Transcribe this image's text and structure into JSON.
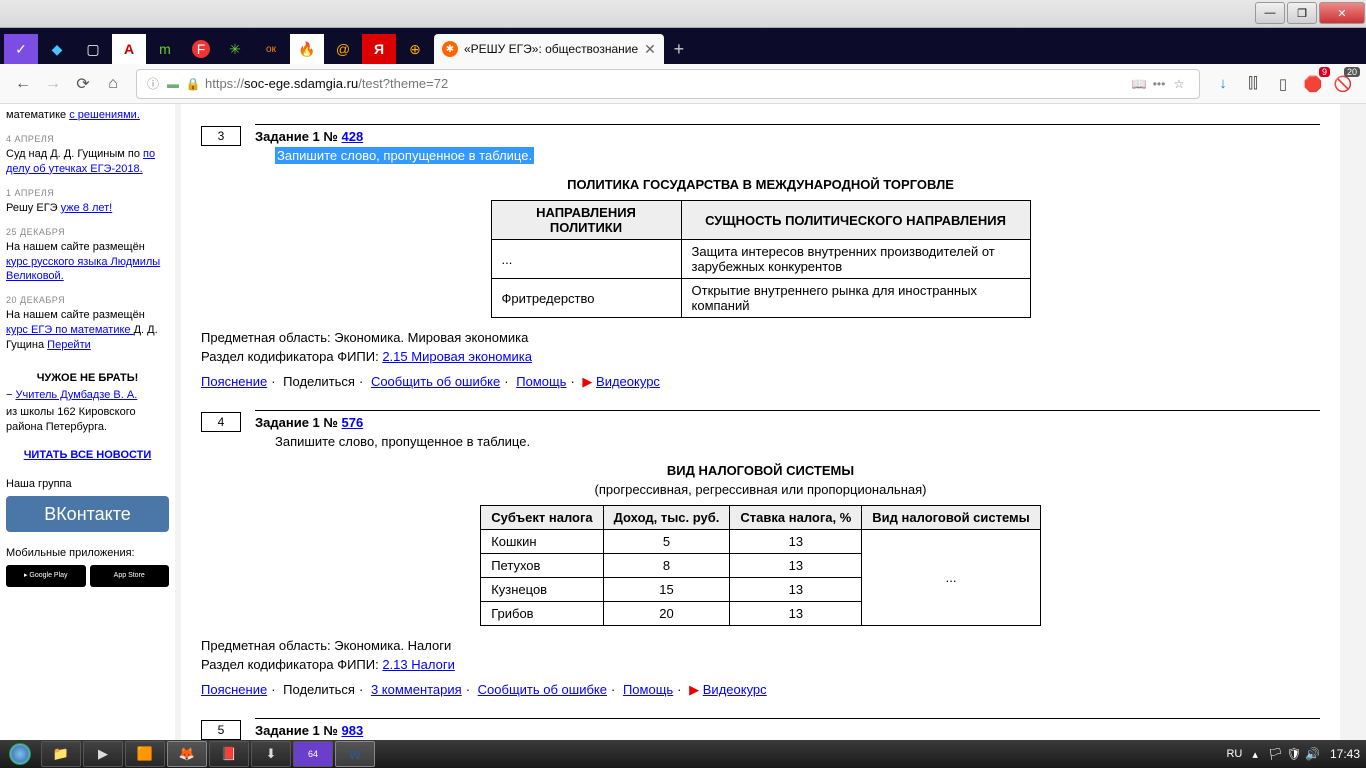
{
  "window": {
    "minimize": "—",
    "maximize": "❐",
    "close": "✕"
  },
  "tabs": {
    "active_title": "«РЕШУ ЕГЭ»: обществознание",
    "close": "✕",
    "new": "+"
  },
  "nav": {
    "back": "←",
    "forward": "→",
    "reload": "⟳",
    "home": "⌂",
    "info": "ⓘ",
    "shield": "🛡",
    "lock": "🔒",
    "url_prefix": "https://",
    "url_host": "soc-ege.sdamgia.ru",
    "url_path": "/test?theme=72",
    "reader": "📖",
    "dots": "•••",
    "star": "☆",
    "download": "↓",
    "library": "⫿⫿",
    "sidebar": "▯",
    "adb": "9",
    "noscript": "20"
  },
  "sidebar": {
    "math_line_a": "математике ",
    "math_line_b": "с решениями.",
    "d1": "4 АПРЕЛЯ",
    "n1a": "Суд над Д. Д. Гущиным по ",
    "n1b": "по делу об утечках ЕГЭ-2018.",
    "d2": "1 АПРЕЛЯ",
    "n2a": "Решу ЕГЭ ",
    "n2b": "уже 8 лет!",
    "d3": "25 ДЕКАБРЯ",
    "n3a": "На нашем сайте размещён ",
    "n3b": "курс русского языка Людмилы Великовой.",
    "d4": "20 ДЕКАБРЯ",
    "n4a": "На нашем сайте размещён ",
    "n4b": "курс ЕГЭ по математике ",
    "n4c": "Д. Д. Гущина ",
    "n4d": "Перейти",
    "heading": "ЧУЖОЕ НЕ БРАТЬ!",
    "teacher_dash": "− ",
    "teacher": "Учитель Думбадзе В. А.",
    "school": "из школы 162 Кировского района Петербурга.",
    "all_news": "ЧИТАТЬ ВСЕ НОВОСТИ",
    "group": "Наша группа",
    "vk": "ВКонтакте",
    "apps": "Мобильные приложения:",
    "gp": "▸ Google Play",
    "as": " App Store"
  },
  "task3": {
    "num": "3",
    "title_a": "Задание 1 № ",
    "title_link": "428",
    "prompt": "Запишите слово, пропущенное в таблице.",
    "subtitle": "ПОЛИТИКА ГОСУДАРСТВА В МЕЖДУНАРОДНОЙ ТОРГОВЛЕ",
    "th1": "НАПРАВЛЕНИЯ ПОЛИТИКИ",
    "th2": "СУЩНОСТЬ ПОЛИТИЧЕСКОГО НАПРАВЛЕНИЯ",
    "r1c1": "...",
    "r1c2": "Защита интересов внутренних производителей от зарубежных конкурентов",
    "r2c1": "Фритредерство",
    "r2c2": "Открытие внутреннего рынка для иностранных компаний",
    "meta1_a": "Предметная область: ",
    "meta1_b": "Экономика. Мировая экономика",
    "meta2_a": "Раздел кодификатора ФИПИ: ",
    "meta2_b": "2.15 Мировая экономика",
    "a_explain": "Пояснение",
    "a_share": "Поделиться",
    "a_report": "Сообщить об ошибке",
    "a_help": "Помощь",
    "a_video": "Видеокурс"
  },
  "task4": {
    "num": "4",
    "title_a": "Задание 1 № ",
    "title_link": "576",
    "prompt": "Запишите слово, пропущенное в таблице.",
    "subtitle": "ВИД НАЛОГОВОЙ СИСТЕМЫ",
    "subtext": "(прогрессивная, регрессивная или пропорциональная)",
    "th1": "Субъект налога",
    "th2": "Доход, тыс. руб.",
    "th3": "Ставка налога, %",
    "th4": "Вид налоговой системы",
    "rows": [
      {
        "c1": "Кошкин",
        "c2": "5",
        "c3": "13"
      },
      {
        "c1": "Петухов",
        "c2": "8",
        "c3": "13"
      },
      {
        "c1": "Кузнецов",
        "c2": "15",
        "c3": "13"
      },
      {
        "c1": "Грибов",
        "c2": "20",
        "c3": "13"
      }
    ],
    "merged": "...",
    "meta1_a": "Предметная область: ",
    "meta1_b": "Экономика. Налоги",
    "meta2_a": "Раздел кодификатора ФИПИ: ",
    "meta2_b": "2.13 Налоги",
    "a_explain": "Пояснение",
    "a_share": "Поделиться",
    "a_comments": "3 комментария",
    "a_report": "Сообщить об ошибке",
    "a_help": "Помощь",
    "a_video": "Видеокурс"
  },
  "task5": {
    "num": "5",
    "title_a": "Задание 1 № ",
    "title_link": "983"
  },
  "tray": {
    "lang": "RU",
    "time": "17:43"
  }
}
